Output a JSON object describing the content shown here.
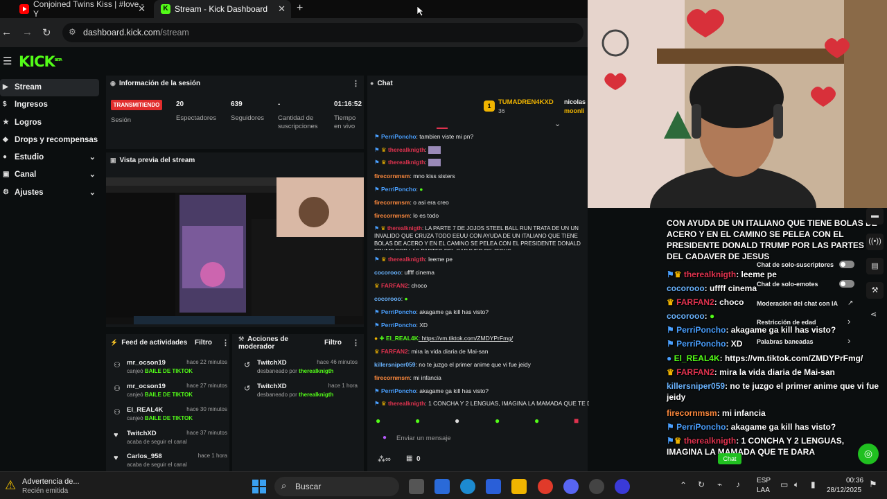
{
  "browser": {
    "tabs": [
      {
        "title": "Conjoined Twins Kiss | #love - Y"
      },
      {
        "title": "Stream - Kick Dashboard"
      }
    ],
    "url_host": "dashboard.kick.com",
    "url_path": "/stream"
  },
  "kick": {
    "logo": "KICK",
    "logo_tag": "BETA",
    "sidebar": [
      {
        "label": "Stream",
        "active": true
      },
      {
        "label": "Ingresos"
      },
      {
        "label": "Logros"
      },
      {
        "label": "Drops y recompensas"
      },
      {
        "label": "Estudio"
      },
      {
        "label": "Canal"
      },
      {
        "label": "Ajustes"
      }
    ],
    "session": {
      "title": "Información de la sesión",
      "status": "TRANSMITIENDO",
      "status_label": "Sesión",
      "viewers": "20",
      "viewers_label": "Espectadores",
      "followers": "639",
      "followers_label": "Seguidores",
      "subs": "-",
      "subs_label": "Cantidad de suscripciones",
      "uptime": "01:16:52",
      "uptime_label": "Tiempo en vivo"
    },
    "preview": {
      "title": "Vista previa del stream"
    },
    "feed": {
      "title": "Feed de actividades",
      "filter": "Filtro",
      "items": [
        {
          "name": "mr_ocson19",
          "action": "canjeó",
          "reward": "BAILE DE TIKTOK",
          "time": "hace 22 minutos"
        },
        {
          "name": "mr_ocson19",
          "action": "canjeó",
          "reward": "BAILE DE TIKTOK",
          "time": "hace 27 minutos"
        },
        {
          "name": "El_REAL4K",
          "action": "canjeó",
          "reward": "BAILE DE TIKTOK",
          "time": "hace 30 minutos"
        },
        {
          "name": "TwitchXD",
          "action": "acaba de seguir el canal",
          "reward": "",
          "time": "hace 37 minutos"
        },
        {
          "name": "Carlos_958",
          "action": "acaba de seguir el canal",
          "reward": "",
          "time": "hace 1 hora"
        }
      ]
    },
    "mod": {
      "title": "Acciones de moderador",
      "filter": "Filtro",
      "items": [
        {
          "name": "TwitchXD",
          "action": "desbaneado por",
          "by": "therealknigth",
          "time": "hace 46 minutos"
        },
        {
          "name": "TwitchXD",
          "action": "desbaneado por",
          "by": "therealknigth",
          "time": "hace 1 hora"
        }
      ]
    },
    "chat": {
      "title": "Chat",
      "top_user": "TUMADREN4KXD",
      "top_count": "36",
      "side_users": [
        "nicolas",
        "moonli"
      ],
      "messages": [
        {
          "user": "PerriPoncho",
          "color": "#4aa0ff",
          "text": ": tambien viste mi pn?"
        },
        {
          "user": "therealknigth",
          "color": "#e0334f",
          "text": ":"
        },
        {
          "user": "therealknigth",
          "color": "#e0334f",
          "text": ":"
        },
        {
          "user": "firecornmsm",
          "color": "#ff8a3d",
          "text": ": mno kiss sisters"
        },
        {
          "user": "PerriPoncho",
          "color": "#4aa0ff",
          "text": ":"
        },
        {
          "user": "firecornmsm",
          "color": "#ff8a3d",
          "text": ": o asi era creo"
        },
        {
          "user": "firecornmsm",
          "color": "#ff8a3d",
          "text": ": lo es todo"
        },
        {
          "user": "therealknigth",
          "color": "#e0334f",
          "text": ": LA PARTE 7 DE JOJOS STEEL BALL RUN TRATA DE UN UN INVALIDO QUE CRUZA TODO EEUU CON AYUDA DE UN ITALIANO QUE TIENE BOLAS DE ACERO Y EN EL CAMINO SE PELEA CON EL PRESIDENTE DONALD TRUMP POR LAS PARTES DEL CADAVER DE JESUS"
        },
        {
          "user": "therealknigth",
          "color": "#e0334f",
          "text": ": leeme pe"
        },
        {
          "user": "cocorooo",
          "color": "#6ab4ff",
          "text": ": uffff cinema"
        },
        {
          "user": "FARFAN2",
          "color": "#e0334f",
          "text": ": choco"
        },
        {
          "user": "cocorooo",
          "color": "#6ab4ff",
          "text": ":"
        },
        {
          "user": "PerriPoncho",
          "color": "#4aa0ff",
          "text": ": akagame ga kill has visto?"
        },
        {
          "user": "PerriPoncho",
          "color": "#4aa0ff",
          "text": ": XD"
        },
        {
          "user": "El_REAL4K",
          "color": "#53fc18",
          "text": ": https://vm.tiktok.com/ZMDYPrFmg/"
        },
        {
          "user": "FARFAN2",
          "color": "#e0334f",
          "text": ": mira la vida diaria de Mai-san"
        },
        {
          "user": "killersniper059",
          "color": "#6ab4ff",
          "text": ": no te juzgo el primer anime que vi fue jeidy"
        },
        {
          "user": "firecornmsm",
          "color": "#ff8a3d",
          "text": ": mi infancia"
        },
        {
          "user": "PerriPoncho",
          "color": "#4aa0ff",
          "text": ": akagame ga kill has visto?"
        },
        {
          "user": "therealknigth",
          "color": "#e0334f",
          "text": ": 1 CONCHA Y 2 LENGUAS, IMAGINA LA MAMADA QUE TE DARA"
        }
      ],
      "input_placeholder": "Enviar un mensaje",
      "points": "0"
    }
  },
  "overlay": {
    "top_text": "CON AYUDA DE UN ITALIANO QUE TIENE BOLAS DE ACERO Y EN EL CAMINO SE PELEA CON EL PRESIDENTE DONALD TRUMP POR LAS PARTES DEL CADAVER DE JESUS",
    "messages": [
      {
        "user": "therealknigth",
        "color": "#e0334f",
        "text": ": leeme pe"
      },
      {
        "user": "cocorooo",
        "color": "#6ab4ff",
        "text": ": uffff cinema"
      },
      {
        "user": "FARFAN2",
        "color": "#e0334f",
        "text": ": choco"
      },
      {
        "user": "cocorooo",
        "color": "#6ab4ff",
        "text": ":"
      },
      {
        "user": "PerriPoncho",
        "color": "#4aa0ff",
        "text": ": akagame ga kill has visto?"
      },
      {
        "user": "PerriPoncho",
        "color": "#4aa0ff",
        "text": ": XD"
      },
      {
        "user": "El_REAL4K",
        "color": "#53fc18",
        "text": ": https://vm.tiktok.com/ZMDYPrFmg/"
      },
      {
        "user": "FARFAN2",
        "color": "#e0334f",
        "text": ": mira la vida diaria de Mai-san"
      },
      {
        "user": "killersniper059",
        "color": "#6ab4ff",
        "text": ": no te juzgo el primer anime que vi fue jeidy"
      },
      {
        "user": "firecornmsm",
        "color": "#ff8a3d",
        "text": ": mi infancia"
      },
      {
        "user": "PerriPoncho",
        "color": "#4aa0ff",
        "text": ": akagame ga kill has visto?"
      },
      {
        "user": "therealknigth",
        "color": "#e0334f",
        "text": ": 1 CONCHA Y 2 LENGUAS, IMAGINA LA MAMADA QUE TE DARA"
      }
    ],
    "settings": {
      "subs_only": "Chat de solo-suscriptores",
      "emotes_only": "Chat de solo-emotes",
      "ai_mod": "Moderación del chat con IA",
      "age": "Restricción de edad",
      "banned_words": "Palabras baneadas"
    },
    "chat_button": "Chat"
  },
  "taskbar": {
    "notif_title": "Advertencia de...",
    "notif_sub": "Recién emitida",
    "search": "Buscar",
    "lang1": "ESP",
    "lang2": "LAA",
    "time": "00:36",
    "date": "28/12/2025"
  }
}
